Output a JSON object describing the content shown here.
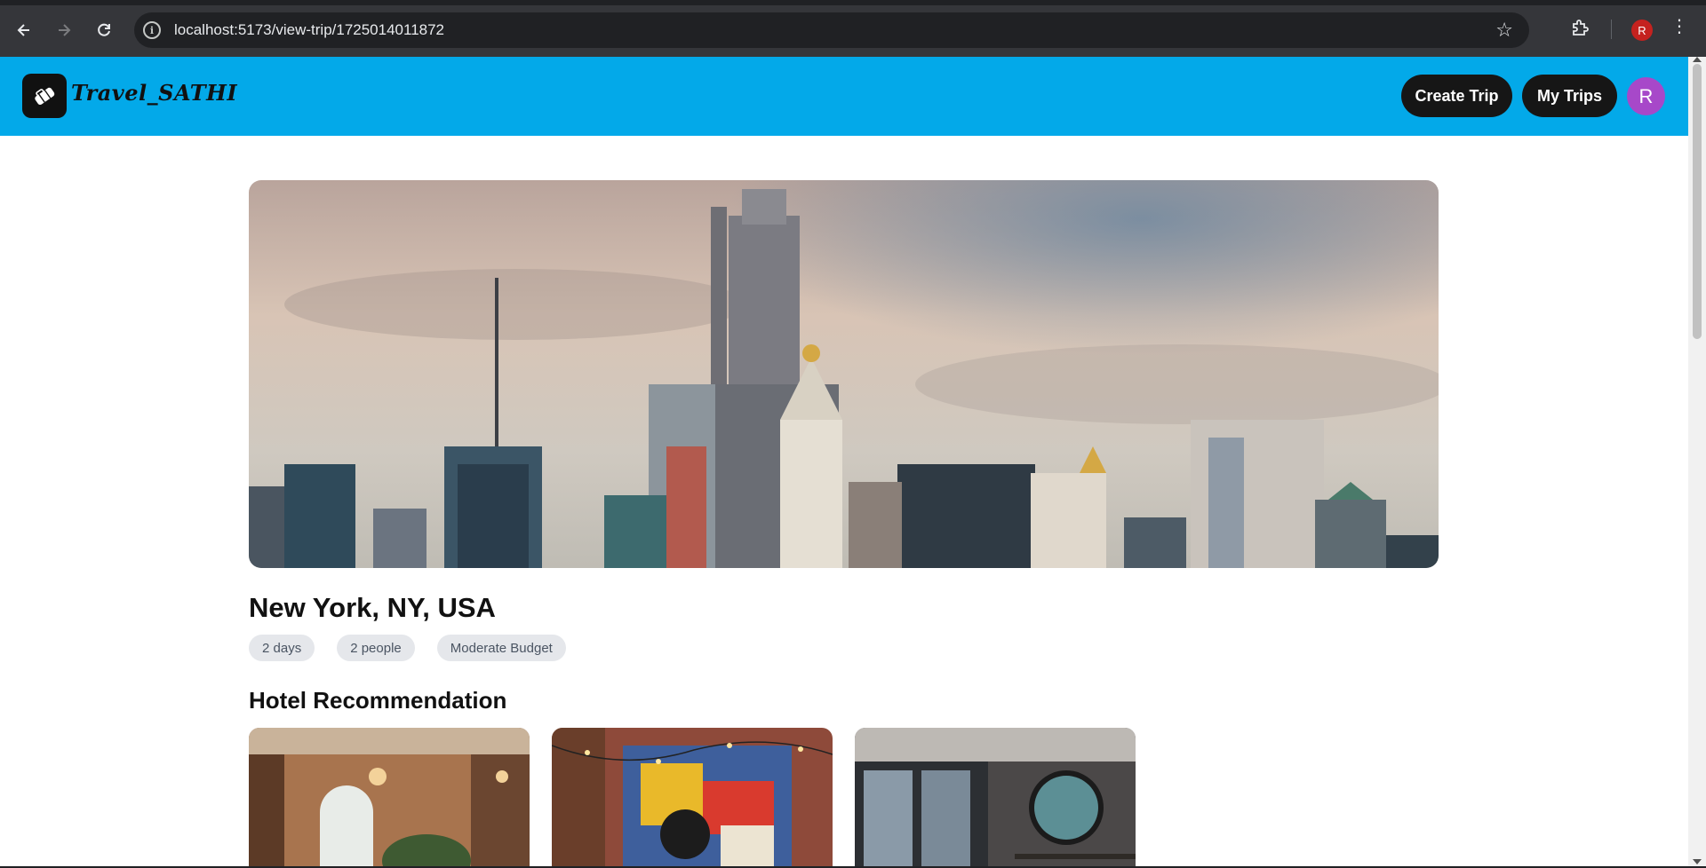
{
  "browser": {
    "url": "localhost:5173/view-trip/1725014011872",
    "profile_initial": "R",
    "icons": [
      "back-icon",
      "forward-icon",
      "reload-icon",
      "site-info-icon",
      "bookmark-star-icon",
      "extensions-icon",
      "menu-dots-icon"
    ]
  },
  "header": {
    "logo_text": "Travel_SATHI",
    "create_trip_label": "Create Trip",
    "my_trips_label": "My Trips",
    "avatar_initial": "R"
  },
  "trip": {
    "location": "New York, NY, USA",
    "chips": [
      "2 days",
      "2 people",
      "Moderate Budget"
    ]
  },
  "hotels": {
    "section_title": "Hotel Recommendation"
  },
  "colors": {
    "header_bg": "#03a9e9",
    "button_bg": "#161616",
    "avatar_bg": "#a748c9",
    "chip_bg": "#e5e7eb"
  }
}
